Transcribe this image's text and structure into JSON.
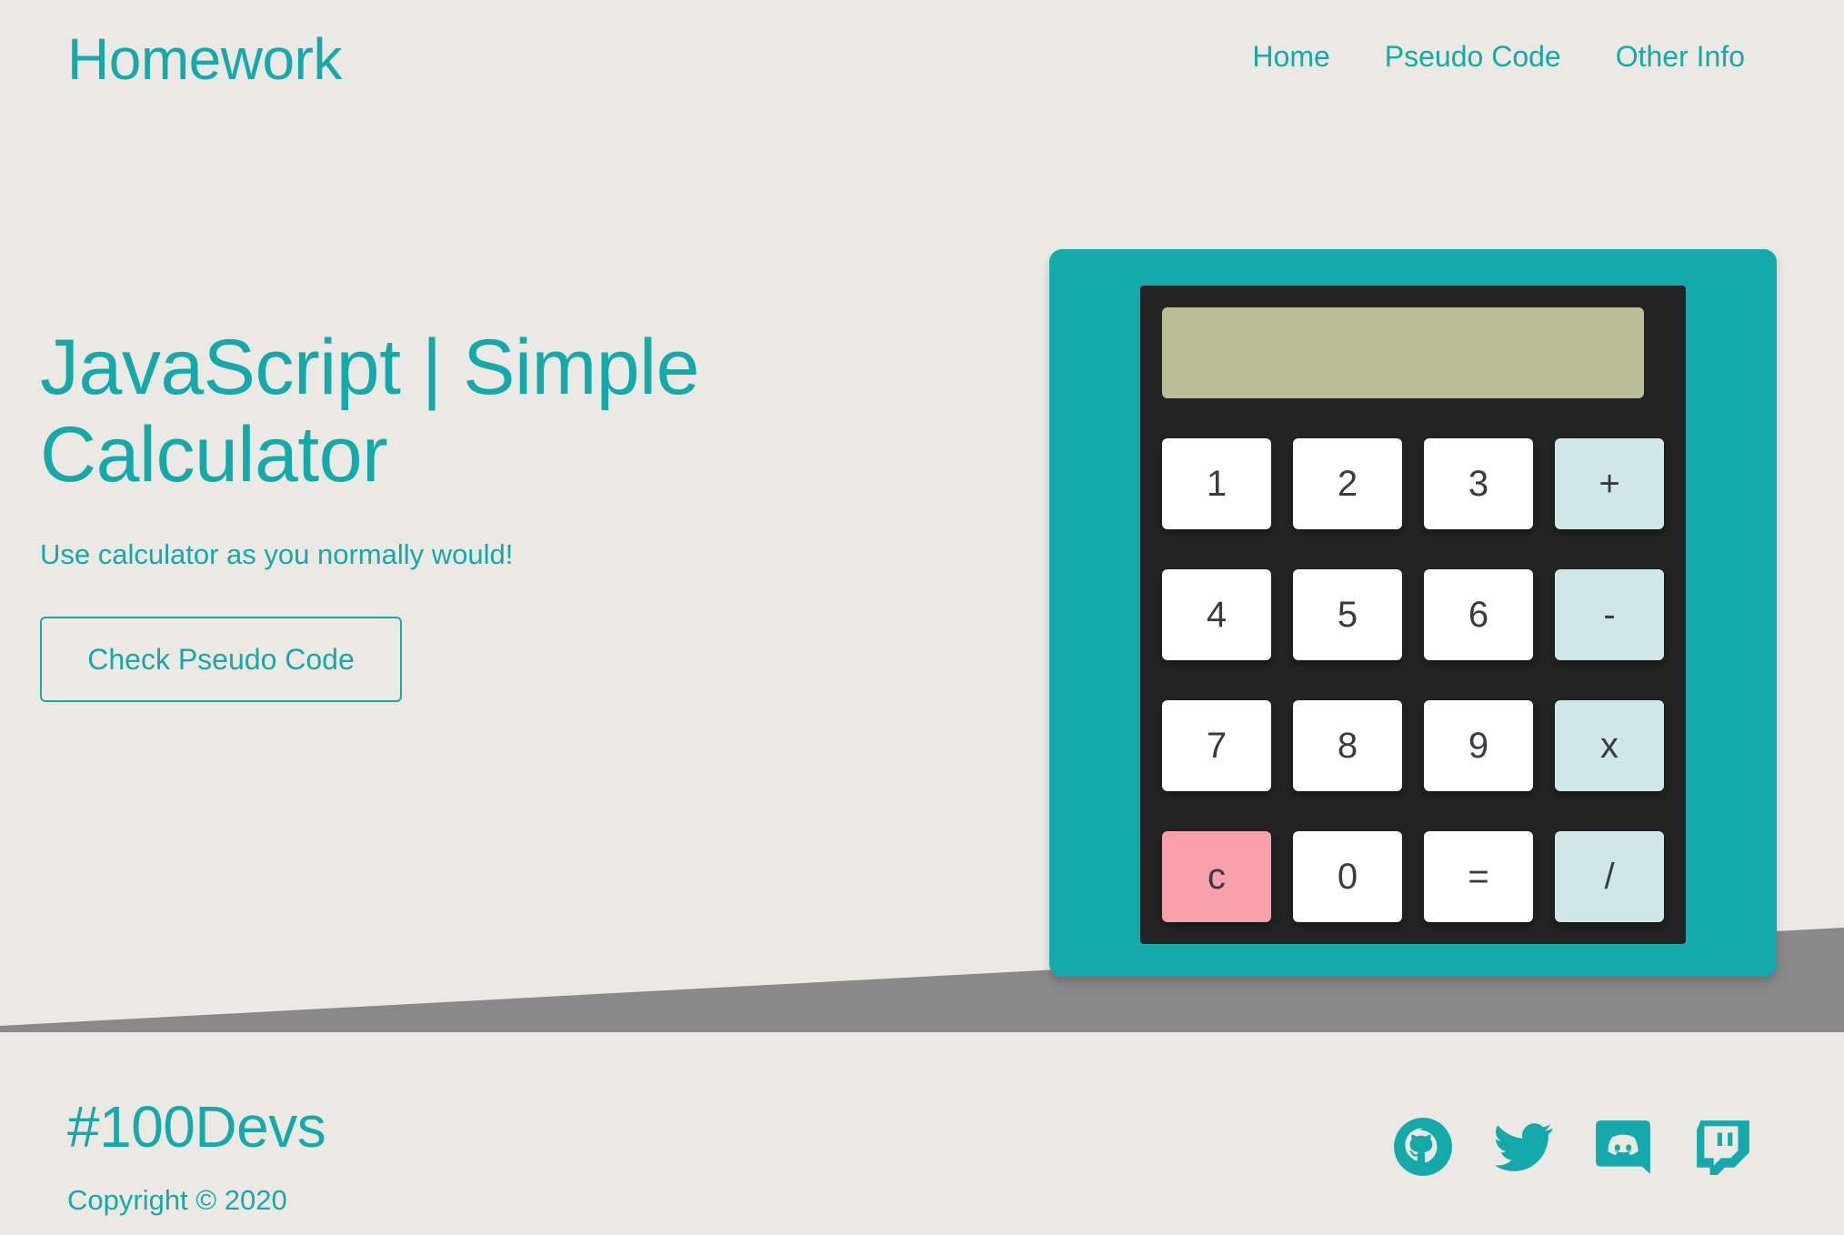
{
  "header": {
    "logo": "Homework",
    "nav": [
      {
        "label": "Home"
      },
      {
        "label": "Pseudo Code"
      },
      {
        "label": "Other Info"
      }
    ]
  },
  "hero": {
    "title": "JavaScript | Simple Calculator",
    "subtitle": "Use calculator as you normally would!",
    "button_label": "Check Pseudo Code"
  },
  "calculator": {
    "display_value": "",
    "keys": [
      {
        "label": "1",
        "kind": "digit"
      },
      {
        "label": "2",
        "kind": "digit"
      },
      {
        "label": "3",
        "kind": "digit"
      },
      {
        "label": "+",
        "kind": "operator"
      },
      {
        "label": "4",
        "kind": "digit"
      },
      {
        "label": "5",
        "kind": "digit"
      },
      {
        "label": "6",
        "kind": "digit"
      },
      {
        "label": "-",
        "kind": "operator"
      },
      {
        "label": "7",
        "kind": "digit"
      },
      {
        "label": "8",
        "kind": "digit"
      },
      {
        "label": "9",
        "kind": "digit"
      },
      {
        "label": "x",
        "kind": "operator"
      },
      {
        "label": "c",
        "kind": "clear"
      },
      {
        "label": "0",
        "kind": "digit"
      },
      {
        "label": "=",
        "kind": "equals"
      },
      {
        "label": "/",
        "kind": "operator"
      }
    ]
  },
  "footer": {
    "brand": "#100Devs",
    "copyright": "Copyright © 2020",
    "socials": [
      {
        "icon": "github-icon"
      },
      {
        "icon": "twitter-icon"
      },
      {
        "icon": "discord-icon"
      },
      {
        "icon": "twitch-icon"
      }
    ]
  },
  "colors": {
    "accent": "#14A9AA",
    "background": "#ECE9E5",
    "wedge": "#898989",
    "calc_inner": "#232323",
    "screen": "#BBBE96",
    "operator_key": "#D0E7E9",
    "clear_key": "#F8A1AA"
  }
}
